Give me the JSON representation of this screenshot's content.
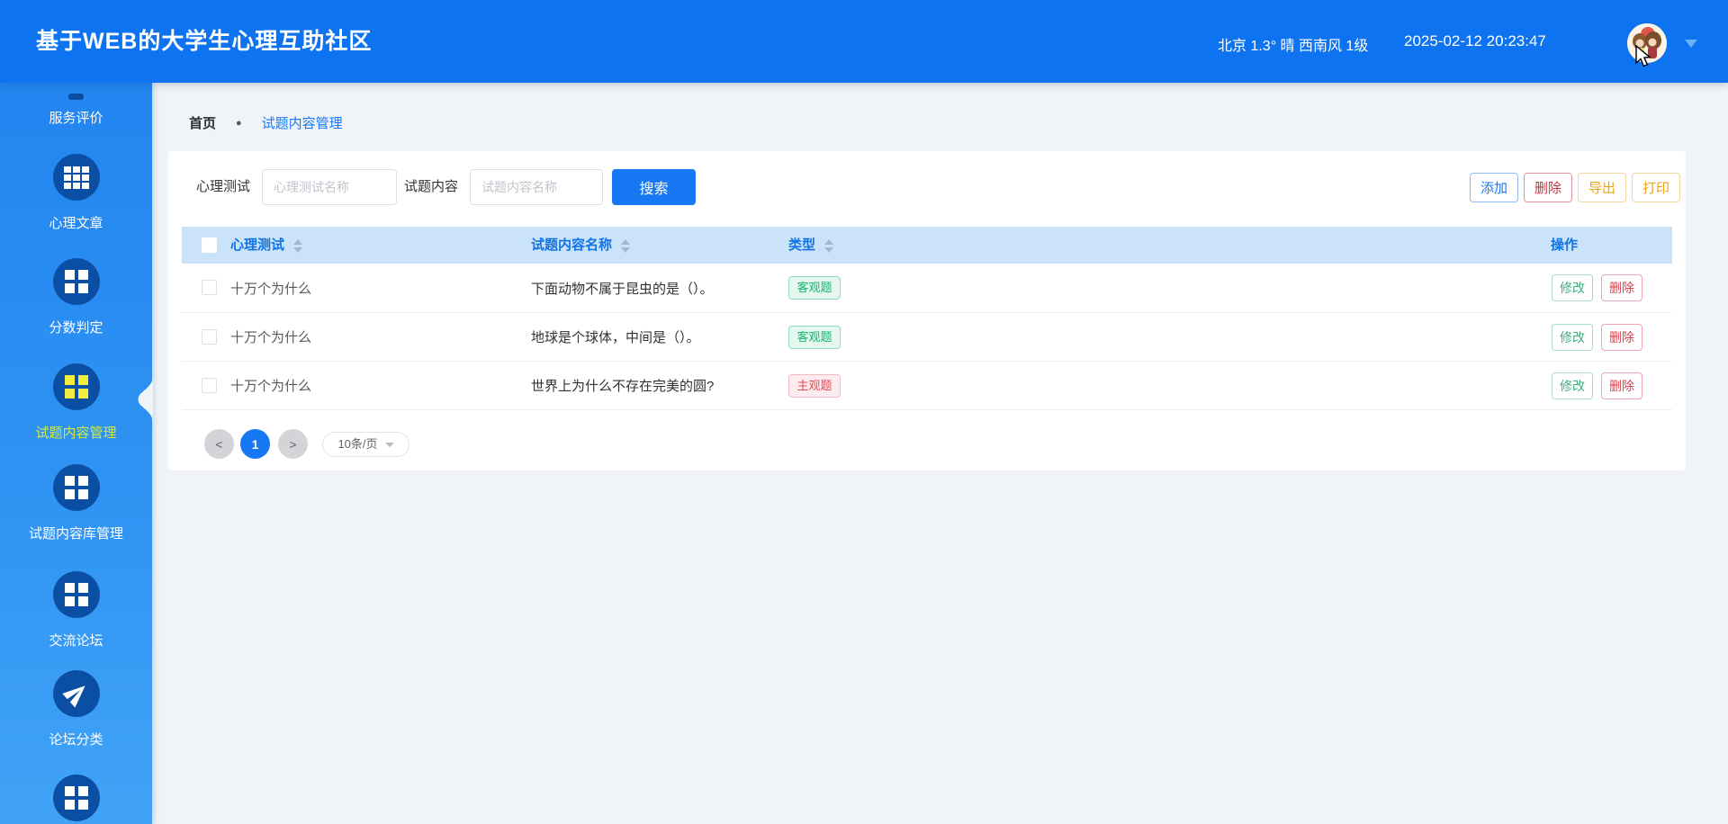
{
  "header": {
    "title": "基于WEB的大学生心理互助社区",
    "weather": "北京 1.3° 晴 西南风 1级",
    "datetime": "2025-02-12 20:23:47"
  },
  "sidebar": {
    "items": [
      {
        "label": "服务评价",
        "icon": "grid-icon",
        "active": false
      },
      {
        "label": "心理文章",
        "icon": "grid-3x3-icon",
        "active": false
      },
      {
        "label": "分数判定",
        "icon": "grid-2x2-icon",
        "active": false
      },
      {
        "label": "试题内容管理",
        "icon": "grid-2x2-icon",
        "active": true
      },
      {
        "label": "试题内容库管理",
        "icon": "grid-2x2-icon",
        "active": false
      },
      {
        "label": "交流论坛",
        "icon": "grid-2x2-icon",
        "active": false
      },
      {
        "label": "论坛分类",
        "icon": "paper-plane-icon",
        "active": false
      },
      {
        "label": "",
        "icon": "grid-2x2-icon",
        "active": false
      }
    ]
  },
  "breadcrumb": {
    "home": "首页",
    "separator": "●",
    "current": "试题内容管理"
  },
  "search": {
    "field1_label": "心理测试",
    "field1_placeholder": "心理测试名称",
    "field1_value": "",
    "field2_label": "试题内容",
    "field2_placeholder": "试题内容名称",
    "field2_value": "",
    "submit_label": "搜索"
  },
  "toolbar": {
    "add": "添加",
    "delete": "删除",
    "export": "导出",
    "print": "打印"
  },
  "table": {
    "headers": {
      "col1": "心理测试",
      "col2": "试题内容名称",
      "col3": "类型",
      "col4": "操作"
    },
    "rows": [
      {
        "test": "十万个为什么",
        "content": "下面动物不属于昆虫的是（）。",
        "type": "客观题",
        "type_color": "green",
        "edit": "修改",
        "delete": "删除"
      },
      {
        "test": "十万个为什么",
        "content": "地球是个球体，中间是（）。",
        "type": "客观题",
        "type_color": "green",
        "edit": "修改",
        "delete": "删除"
      },
      {
        "test": "十万个为什么",
        "content": "世界上为什么不存在完美的圆?",
        "type": "主观题",
        "type_color": "red",
        "edit": "修改",
        "delete": "删除"
      }
    ]
  },
  "pagination": {
    "prev": "<",
    "page": "1",
    "next": ">",
    "page_size": "10条/页"
  },
  "colors": {
    "header_bg": "#0d73f1",
    "sidebar_top": "#2385f0",
    "sidebar_bottom": "#41a3f7",
    "icon_circle": "#0b4fa4",
    "active_item": "#d4ea44",
    "accent_blue": "#1877f2",
    "table_header_bg": "#cbe3f8",
    "tag_green": "#16b56f",
    "tag_red": "#e34a59",
    "danger_red": "#c03540",
    "warn_orange": "#e9a51c",
    "page_bg": "#f0f3f8"
  }
}
